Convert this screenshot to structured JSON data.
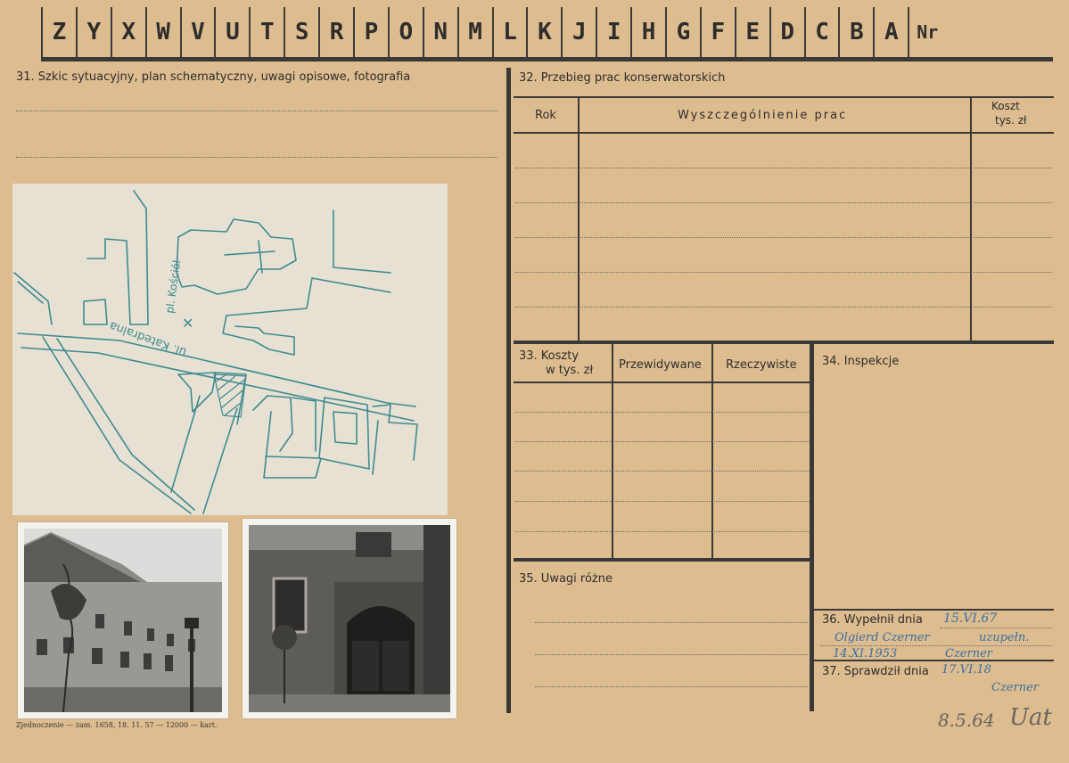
{
  "header": {
    "letters": [
      "Z",
      "Y",
      "X",
      "W",
      "V",
      "U",
      "T",
      "S",
      "R",
      "P",
      "O",
      "N",
      "M",
      "L",
      "K",
      "J",
      "I",
      "H",
      "G",
      "F",
      "E",
      "D",
      "C",
      "B",
      "A"
    ],
    "nr_label": "Nr"
  },
  "section31": {
    "title": "31. Szkic sytuacyjny, plan schematyczny, uwagi opisowe, fotografia"
  },
  "sketch": {
    "label_church": "pl. Kościół",
    "label_street": "ul. Katedralna"
  },
  "section32": {
    "title": "32. Przebieg prac konserwatorskich",
    "col_rok": "Rok",
    "col_desc": "Wyszczególnienie prac",
    "col_cost_1": "Koszt",
    "col_cost_2": "tys. zł"
  },
  "section33": {
    "title_1": "33. Koszty",
    "title_2": "w tys. zł",
    "col_planned": "Przewidywane",
    "col_actual": "Rzeczywiste"
  },
  "section34": {
    "title": "34. Inspekcje"
  },
  "section35": {
    "title": "35. Uwagi różne"
  },
  "section36": {
    "title": "36. Wypełnił dnia",
    "date": "15.VI.67",
    "line1_name": "Olgierd Czerner",
    "line1_note": "uzupełn.",
    "line2_date": "14.XI.1953",
    "line2_name": "Czerner"
  },
  "section37": {
    "title": "37. Sprawdził dnia",
    "date": "17.VI.18",
    "signature": "Czerner"
  },
  "annotation": {
    "date": "8.5.64",
    "initials": "Uat"
  },
  "footer": {
    "text": "Zjednoczenie — zam. 1658, 18. 11. 57 — 12000 — kart."
  },
  "colors": {
    "card": "#ddbc90",
    "ink": "#3a6fa0",
    "rule": "#3a3937"
  }
}
